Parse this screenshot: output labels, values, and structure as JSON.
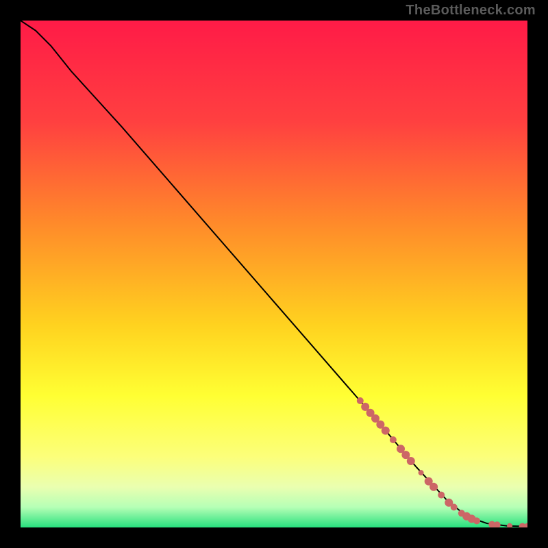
{
  "watermark": "TheBottleneck.com",
  "chart_data": {
    "type": "line",
    "xlim": [
      0,
      100
    ],
    "ylim": [
      0,
      100
    ],
    "grid": false,
    "legend": null,
    "background_gradient": {
      "stops": [
        {
          "offset": 0.0,
          "color": "#ff1b47"
        },
        {
          "offset": 0.2,
          "color": "#ff4040"
        },
        {
          "offset": 0.4,
          "color": "#ff8a2a"
        },
        {
          "offset": 0.6,
          "color": "#ffd21f"
        },
        {
          "offset": 0.74,
          "color": "#ffff33"
        },
        {
          "offset": 0.86,
          "color": "#fcff7a"
        },
        {
          "offset": 0.92,
          "color": "#eaffb0"
        },
        {
          "offset": 0.96,
          "color": "#b6ffb6"
        },
        {
          "offset": 1.0,
          "color": "#27e07d"
        }
      ]
    },
    "curve": [
      {
        "x": 0,
        "y": 100
      },
      {
        "x": 3,
        "y": 98
      },
      {
        "x": 6,
        "y": 95
      },
      {
        "x": 10,
        "y": 90
      },
      {
        "x": 20,
        "y": 79
      },
      {
        "x": 30,
        "y": 67.5
      },
      {
        "x": 40,
        "y": 56
      },
      {
        "x": 50,
        "y": 44.5
      },
      {
        "x": 60,
        "y": 33
      },
      {
        "x": 70,
        "y": 21.5
      },
      {
        "x": 78,
        "y": 12
      },
      {
        "x": 84,
        "y": 5.5
      },
      {
        "x": 88,
        "y": 2.2
      },
      {
        "x": 92,
        "y": 0.8
      },
      {
        "x": 96,
        "y": 0.3
      },
      {
        "x": 100,
        "y": 0.2
      }
    ],
    "markers": {
      "color": "#cc6666",
      "points": [
        {
          "x": 67,
          "y": 25,
          "r": 5
        },
        {
          "x": 68,
          "y": 23.8,
          "r": 6
        },
        {
          "x": 69,
          "y": 22.6,
          "r": 6
        },
        {
          "x": 70,
          "y": 21.5,
          "r": 6
        },
        {
          "x": 71,
          "y": 20.3,
          "r": 6
        },
        {
          "x": 72,
          "y": 19.1,
          "r": 6
        },
        {
          "x": 73.5,
          "y": 17.3,
          "r": 5
        },
        {
          "x": 75,
          "y": 15.5,
          "r": 6
        },
        {
          "x": 76,
          "y": 14.3,
          "r": 6
        },
        {
          "x": 77,
          "y": 13.1,
          "r": 6
        },
        {
          "x": 79,
          "y": 10.8,
          "r": 4
        },
        {
          "x": 80.5,
          "y": 9.1,
          "r": 6
        },
        {
          "x": 81.5,
          "y": 8.0,
          "r": 6
        },
        {
          "x": 83,
          "y": 6.4,
          "r": 5
        },
        {
          "x": 84.5,
          "y": 4.9,
          "r": 6
        },
        {
          "x": 85.5,
          "y": 4.0,
          "r": 5
        },
        {
          "x": 87,
          "y": 2.8,
          "r": 5
        },
        {
          "x": 88,
          "y": 2.2,
          "r": 6
        },
        {
          "x": 89,
          "y": 1.7,
          "r": 6
        },
        {
          "x": 90,
          "y": 1.3,
          "r": 5
        },
        {
          "x": 93,
          "y": 0.6,
          "r": 5
        },
        {
          "x": 94,
          "y": 0.5,
          "r": 5
        },
        {
          "x": 96.5,
          "y": 0.3,
          "r": 4
        },
        {
          "x": 99,
          "y": 0.2,
          "r": 5
        },
        {
          "x": 100,
          "y": 0.2,
          "r": 5
        }
      ]
    }
  }
}
